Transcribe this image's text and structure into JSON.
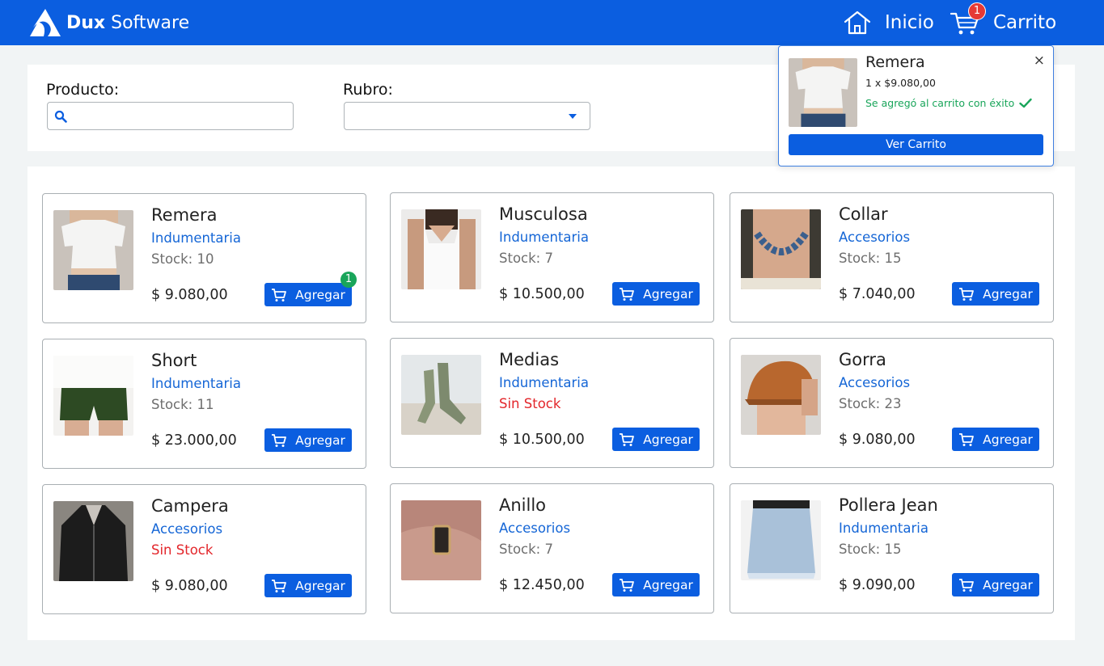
{
  "header": {
    "brand_bold": "Dux",
    "brand_rest": " Software",
    "nav": {
      "home_label": "Inicio",
      "cart_label": "Carrito",
      "cart_count": "1"
    }
  },
  "filters": {
    "product_label": "Producto:",
    "product_value": "",
    "category_label": "Rubro:",
    "category_value": ""
  },
  "colors": {
    "primary": "#0b5ee0",
    "category_text": "#1566d6",
    "out_of_stock": "#e3262b",
    "success": "#19a55a",
    "badge": "#e53935"
  },
  "add_button_label": "Agregar",
  "products": [
    {
      "name": "Remera",
      "category": "Indumentaria",
      "stock": "Stock: 10",
      "stock_status": "in",
      "price": "$ 9.080,00",
      "in_cart": "1",
      "image": "white-tshirt"
    },
    {
      "name": "Musculosa",
      "category": "Indumentaria",
      "stock": "Stock: 7",
      "stock_status": "in",
      "price": "$ 10.500,00",
      "image": "white-tank-top"
    },
    {
      "name": "Collar",
      "category": "Accesorios",
      "stock": "Stock: 15",
      "stock_status": "in",
      "price": "$ 7.040,00",
      "image": "blue-necklace"
    },
    {
      "name": "Short",
      "category": "Indumentaria",
      "stock": "Stock: 11",
      "stock_status": "in",
      "price": "$ 23.000,00",
      "image": "green-shorts"
    },
    {
      "name": "Medias",
      "category": "Indumentaria",
      "stock": "Sin Stock",
      "stock_status": "out",
      "price": "$ 10.500,00",
      "image": "grey-socks"
    },
    {
      "name": "Gorra",
      "category": "Accesorios",
      "stock": "Stock: 23",
      "stock_status": "in",
      "price": "$ 9.080,00",
      "image": "orange-cap"
    },
    {
      "name": "Campera",
      "category": "Accesorios",
      "stock": "Sin Stock",
      "stock_status": "out",
      "price": "$ 9.080,00",
      "image": "leather-jacket"
    },
    {
      "name": "Anillo",
      "category": "Accesorios",
      "stock": "Stock: 7",
      "stock_status": "in",
      "price": "$ 12.450,00",
      "image": "ring"
    },
    {
      "name": "Pollera Jean",
      "category": "Indumentaria",
      "stock": "Stock: 15",
      "stock_status": "in",
      "price": "$ 9.090,00",
      "image": "denim-skirt"
    }
  ],
  "popup": {
    "name": "Remera",
    "qty_text": "1 x $9.080,00",
    "message": "Se agregó al carrito con éxito",
    "close": "×",
    "button": "Ver Carrito",
    "image": "white-tshirt"
  }
}
